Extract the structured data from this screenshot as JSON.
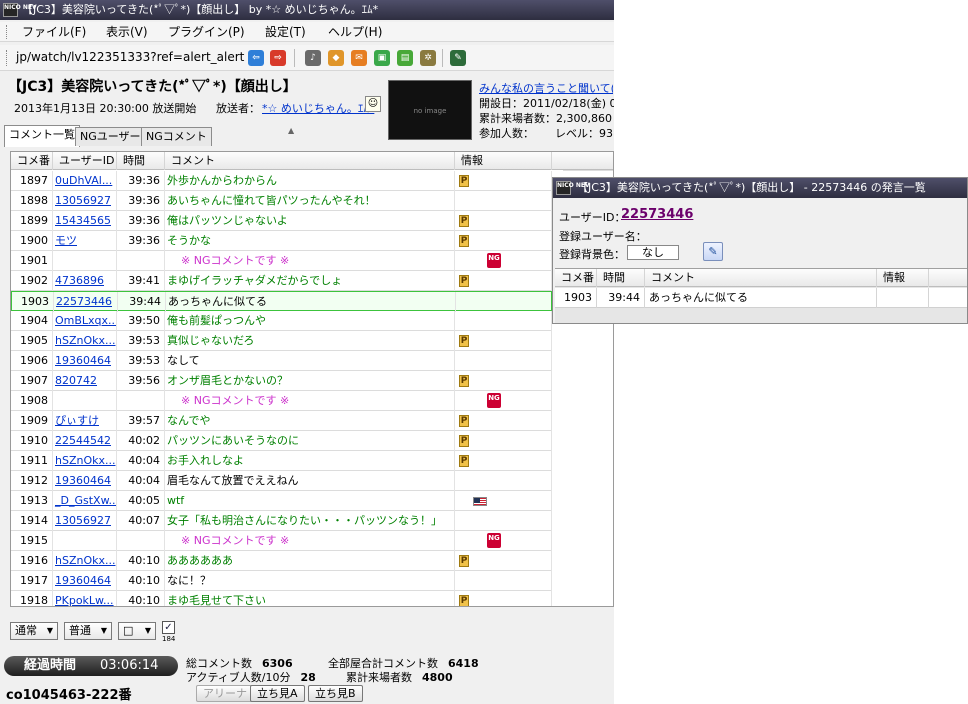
{
  "main_window": {
    "title": "【JC3】美容院いってきた(*ﾟ▽ﾟ*)【顔出し】 by *☆ めいじちゃん。ｴﾑ*",
    "app_icon_text": "NICO NEV"
  },
  "menu": {
    "items": [
      "ファイル(F)",
      "表示(V)",
      "プラグイン(P)",
      "設定(T)",
      "ヘルプ(H)"
    ]
  },
  "toolbar": {
    "url": "jp/watch/lv122351333?ref=alert_alert"
  },
  "broadcast": {
    "title": "【JC3】美容院いってきた(*ﾟ▽ﾟ*)【顔出し】",
    "date": "2013年1月13日 20:30:00 放送開始",
    "caster_label": "放送者：",
    "caster": "*☆ めいじちゃん。ｴﾑ*",
    "thumbnail_text": "no image"
  },
  "community": {
    "link": "みんな私の言うこと聞いて(*´…",
    "opened": "開設日：2011/02/18(金) 09:52",
    "total_visitors": "累計来場者数：2,300,860",
    "members": "参加人数：",
    "level": "レベル：93"
  },
  "tabs": [
    "コメント一覧",
    "NGユーザー",
    "NGコメント"
  ],
  "table": {
    "headers": [
      "コメ番",
      "ユーザーID",
      "時間",
      "コメント",
      "情報"
    ],
    "rows": [
      {
        "no": "1897",
        "uid": "0uDhVAl...",
        "time": "39:36",
        "comment": "外歩かんからわからん",
        "style": "green",
        "info": "p"
      },
      {
        "no": "1898",
        "uid": "13056927",
        "time": "39:36",
        "comment": "あいちゃんに憧れて皆パツったんやそれ！",
        "style": "green",
        "info": ""
      },
      {
        "no": "1899",
        "uid": "15434565",
        "time": "39:36",
        "comment": "俺はパッツンじゃないよ",
        "style": "green",
        "info": "p"
      },
      {
        "no": "1900",
        "uid": "モツ",
        "time": "39:36",
        "comment": "そうかな",
        "style": "green",
        "info": "p"
      },
      {
        "no": "1901",
        "uid": "",
        "time": "",
        "comment": "※ NGコメントです ※",
        "style": "ng",
        "info": "ng"
      },
      {
        "no": "1902",
        "uid": "4736896",
        "time": "39:41",
        "comment": "まゆげイラッチャダメだからでしょ",
        "style": "green",
        "info": "p"
      },
      {
        "no": "1903",
        "uid": "22573446",
        "time": "39:44",
        "comment": "あっちゃんに似てる",
        "style": "black",
        "info": ""
      },
      {
        "no": "1904",
        "uid": "OmBLxqx...",
        "time": "39:50",
        "comment": "俺も前髪ぱっつんや",
        "style": "green",
        "info": ""
      },
      {
        "no": "1905",
        "uid": "hSZnOkx...",
        "time": "39:53",
        "comment": "真似じゃないだろ",
        "style": "green",
        "info": "p"
      },
      {
        "no": "1906",
        "uid": "19360464",
        "time": "39:53",
        "comment": "なして",
        "style": "black",
        "info": ""
      },
      {
        "no": "1907",
        "uid": "820742",
        "time": "39:56",
        "comment": "オンザ眉毛とかないの？",
        "style": "green",
        "info": "p"
      },
      {
        "no": "1908",
        "uid": "",
        "time": "",
        "comment": "※ NGコメントです ※",
        "style": "ng",
        "info": "ng"
      },
      {
        "no": "1909",
        "uid": "ぴぃすけ",
        "time": "39:57",
        "comment": "なんでや",
        "style": "green",
        "info": "p"
      },
      {
        "no": "1910",
        "uid": "22544542",
        "time": "40:02",
        "comment": "パッツンにあいそうなのに",
        "style": "green",
        "info": "p"
      },
      {
        "no": "1911",
        "uid": "hSZnOkx...",
        "time": "40:04",
        "comment": "お手入れしなよ",
        "style": "green",
        "info": "p"
      },
      {
        "no": "1912",
        "uid": "19360464",
        "time": "40:04",
        "comment": "眉毛なんて放置でええねん",
        "style": "black",
        "info": ""
      },
      {
        "no": "1913",
        "uid": "_D_GstXw...",
        "time": "40:05",
        "comment": "wtf",
        "style": "green",
        "info": "flag"
      },
      {
        "no": "1914",
        "uid": "13056927",
        "time": "40:07",
        "comment": "女子「私も明治さんになりたい・・・パッツンなう！」",
        "style": "green",
        "info": ""
      },
      {
        "no": "1915",
        "uid": "",
        "time": "",
        "comment": "※ NGコメントです ※",
        "style": "ng",
        "info": "ng"
      },
      {
        "no": "1916",
        "uid": "hSZnOkx...",
        "time": "40:10",
        "comment": "ああああああ",
        "style": "green",
        "info": "p"
      },
      {
        "no": "1917",
        "uid": "19360464",
        "time": "40:10",
        "comment": "なに！？",
        "style": "black",
        "info": ""
      },
      {
        "no": "1918",
        "uid": "PKpokLw...",
        "time": "40:10",
        "comment": "まゆ毛見せて下さい",
        "style": "green",
        "info": "p"
      }
    ],
    "selected_no": "1903"
  },
  "controls": {
    "dd1": "通常",
    "dd2": "普通",
    "dd3": "□",
    "chk_label": "184"
  },
  "status": {
    "elapsed_label": "経過時間",
    "elapsed_value": "03:06:14",
    "total_comments_label": "総コメント数",
    "total_comments": "6306",
    "all_rooms_label": "全部屋合計コメント数",
    "all_rooms": "6418",
    "active_label": "アクティブ人数/10分",
    "active": "28",
    "visitors_label": "累計来場者数",
    "visitors": "4800",
    "community_id": "co1045463-222番",
    "buttons": [
      "アリーナ",
      "立ち見A",
      "立ち見B"
    ]
  },
  "user_window": {
    "title": "【JC3】美容院いってきた(*ﾟ▽ﾟ*)【顔出し】 - 22573446 の発言一覧",
    "user_id_label": "ユーザーID：",
    "user_id": "22573446",
    "user_name_label": "登録ユーザー名：",
    "bg_color_label": "登録背景色：",
    "bg_color_value": "なし",
    "headers": [
      "コメ番",
      "時間",
      "コメント",
      "情報"
    ],
    "row": {
      "no": "1903",
      "time": "39:44",
      "comment": "あっちゃんに似てる"
    }
  },
  "colors": {
    "title_bar": "#3a3a50",
    "link": "#0033cc",
    "comment_green": "#008000",
    "ng_pink": "#cc33cc",
    "selection_border": "#3cc33c",
    "user_id_purple": "#6b006b"
  }
}
